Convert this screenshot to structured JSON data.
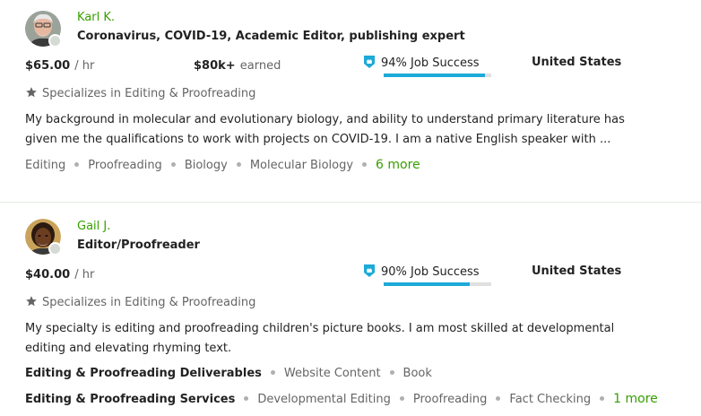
{
  "freelancers": [
    {
      "name": "Karl K.",
      "title": "Coronavirus, COVID-19, Academic Editor, publishing expert",
      "rate": "$65.00",
      "rate_unit": "/ hr",
      "earned_amount": "$80k+",
      "earned_label": "earned",
      "job_success": "94% Job Success",
      "job_success_pct": 94,
      "country": "United States",
      "specializes": "Specializes in Editing & Proofreading",
      "description_line1": "My background in molecular and evolutionary biology, and ability to understand primary literature has",
      "description_line2": "given me the qualifications to work with projects on COVID-19. I am a native English speaker with ...",
      "skills": [
        "Editing",
        "Proofreading",
        "Biology",
        "Molecular Biology"
      ],
      "more": "6 more"
    },
    {
      "name": "Gail J.",
      "title": "Editor/Proofreader",
      "rate": "$40.00",
      "rate_unit": "/ hr",
      "job_success": "90% Job Success",
      "job_success_pct": 90,
      "country": "United States",
      "specializes": "Specializes in Editing & Proofreading",
      "description_line1": "My specialty is editing and proofreading children's picture books. I am most skilled at developmental",
      "description_line2": "editing and elevating rhyming text.",
      "deliverables_label": "Editing & Proofreading Deliverables",
      "deliverables": [
        "Website Content",
        "Book"
      ],
      "services_label": "Editing & Proofreading Services",
      "services": [
        "Developmental Editing",
        "Proofreading",
        "Fact Checking"
      ],
      "more": "1 more"
    }
  ],
  "colors": {
    "name_green": "#37a000",
    "progress_blue": "#1caad8",
    "badge_blue": "#1caad8",
    "muted_text": "#656565"
  },
  "icons": [
    "avatar",
    "job-success-badge-icon",
    "star-icon"
  ]
}
